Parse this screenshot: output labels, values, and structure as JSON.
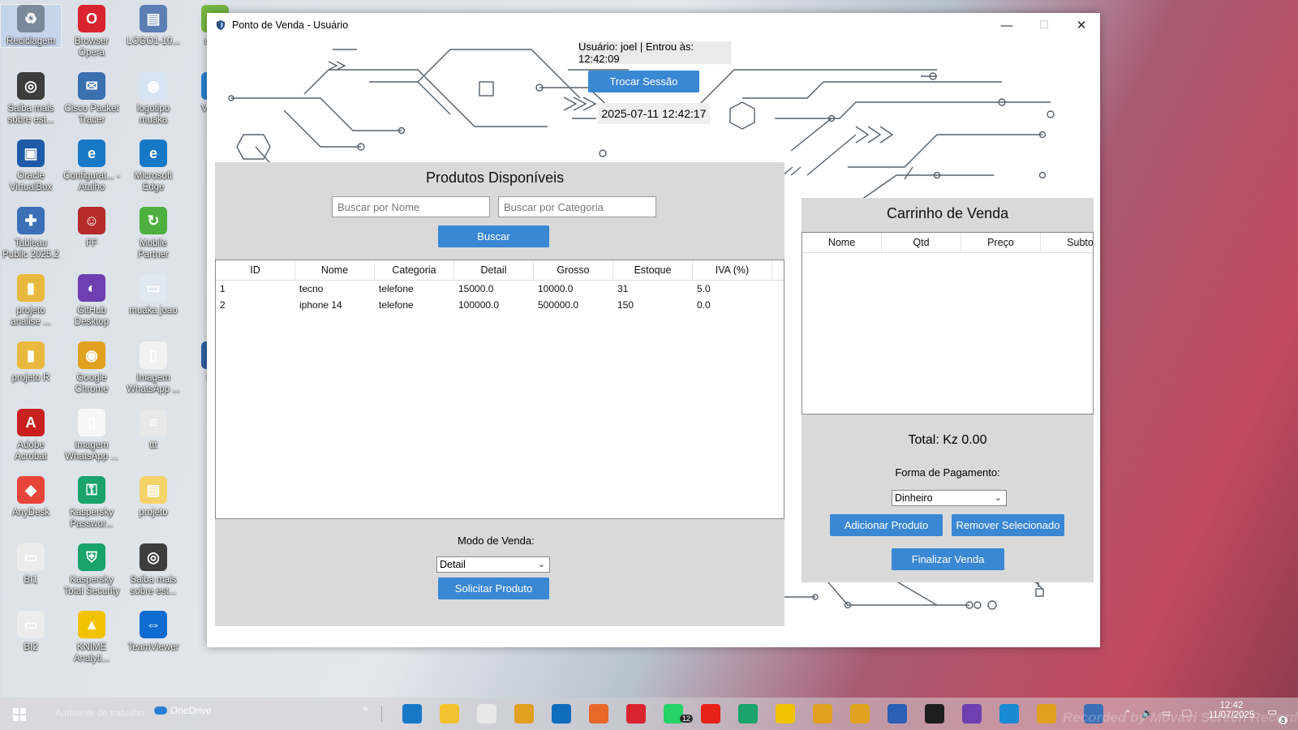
{
  "desktop": {
    "icons": [
      {
        "label": "Reciclagem",
        "color": "#7a8a9a",
        "glyph": "♻"
      },
      {
        "label": "Browser Opera",
        "color": "#d9232e",
        "glyph": "O"
      },
      {
        "label": "LOGO1-10...",
        "color": "#5b7fb5",
        "glyph": "▤"
      },
      {
        "label": "uTorr",
        "color": "#77b843",
        "glyph": "µ"
      },
      {
        "label": "Saiba mais sobre est...",
        "color": "#3d3d3d",
        "glyph": "◎"
      },
      {
        "label": "Cisco Packet Tracer",
        "color": "#3a6fb0",
        "glyph": "✉"
      },
      {
        "label": "logotipo muaka",
        "color": "#d5e3f2",
        "glyph": "◉"
      },
      {
        "label": "Visu C",
        "color": "#2c7fd0",
        "glyph": "V"
      },
      {
        "label": "Oracle VirtualBox",
        "color": "#1e5aa8",
        "glyph": "▣"
      },
      {
        "label": "Configurat... - Atalho",
        "color": "#1878c8",
        "glyph": "e"
      },
      {
        "label": "Microsoft Edge",
        "color": "#1878c8",
        "glyph": "e"
      },
      {
        "label": "Tableau Public 2025.2",
        "color": "#3b6fb6",
        "glyph": "✚"
      },
      {
        "label": "FF",
        "color": "#b52a2a",
        "glyph": "☺"
      },
      {
        "label": "Mobile Partner",
        "color": "#4caf3e",
        "glyph": "↻"
      },
      {
        "label": "projeto analise ...",
        "color": "#e8b93c",
        "glyph": "▮"
      },
      {
        "label": "GitHub Desktop",
        "color": "#6e3fb0",
        "glyph": "◐"
      },
      {
        "label": "muaka joao",
        "color": "#dfe7f0",
        "glyph": "▭"
      },
      {
        "label": "projeto R",
        "color": "#e8b93c",
        "glyph": "▮"
      },
      {
        "label": "Google Chrome",
        "color": "#e0a020",
        "glyph": "◉"
      },
      {
        "label": "Imagem WhatsApp ...",
        "color": "#f2f2f2",
        "glyph": "▯"
      },
      {
        "label": "Pho",
        "color": "#3060a0",
        "glyph": "P"
      },
      {
        "label": "Adobe Acrobat",
        "color": "#c8201e",
        "glyph": "A"
      },
      {
        "label": "Imagem WhatsApp ...",
        "color": "#f7f7f7",
        "glyph": "▯"
      },
      {
        "label": "ttt",
        "color": "#e8e8e8",
        "glyph": "≡"
      },
      {
        "label": "AnyDesk",
        "color": "#e8453a",
        "glyph": "◆"
      },
      {
        "label": "Kaspersky Passwor...",
        "color": "#1aa36b",
        "glyph": "⚿"
      },
      {
        "label": "projeto",
        "color": "#f3d36a",
        "glyph": "▤"
      },
      {
        "label": "BI1",
        "color": "#ececec",
        "glyph": "▭"
      },
      {
        "label": "Kaspersky Total Security",
        "color": "#1aa36b",
        "glyph": "⛨"
      },
      {
        "label": "Saiba mais sobre est...",
        "color": "#3d3d3d",
        "glyph": "◎"
      },
      {
        "label": "BI2",
        "color": "#ececec",
        "glyph": "▭"
      },
      {
        "label": "KNIME Analyti...",
        "color": "#f2c200",
        "glyph": "▲"
      },
      {
        "label": "TeamViewer",
        "color": "#0e6bd0",
        "glyph": "⇔"
      }
    ]
  },
  "window": {
    "title": "Ponto de Venda - Usuário",
    "minimize_glyph": "—",
    "maximize_glyph": "☐",
    "close_glyph": "✕"
  },
  "header": {
    "user_info": "Usuário: joel | Entrou às: 12:42:09",
    "switch_session_label": "Trocar Sessão",
    "datetime": "2025-07-11 12:42:17"
  },
  "products": {
    "title": "Produtos Disponíveis",
    "search_name_placeholder": "Buscar por Nome",
    "search_category_placeholder": "Buscar por Categoria",
    "search_button": "Buscar",
    "columns": [
      "ID",
      "Nome",
      "Categoria",
      "Detail",
      "Grosso",
      "Estoque",
      "IVA (%)"
    ],
    "rows": [
      [
        "1",
        "tecno",
        "telefone",
        "15000.0",
        "10000.0",
        "31",
        "5.0"
      ],
      [
        "2",
        "iphone 14",
        "telefone",
        "100000.0",
        "500000.0",
        "150",
        "0.0"
      ]
    ],
    "sale_mode_label": "Modo de Venda:",
    "sale_mode_value": "Detail",
    "request_button": "Solicitar Produto"
  },
  "cart": {
    "title": "Carrinho de Venda",
    "columns": [
      "Nome",
      "Qtd",
      "Preço",
      "Subto"
    ],
    "total": "Total: Kz 0.00",
    "payment_label": "Forma de Pagamento:",
    "payment_value": "Dinheiro",
    "add_button": "Adicionar Produto",
    "remove_button": "Remover Selecionado",
    "finish_button": "Finalizar Venda"
  },
  "taskbar": {
    "workspace_label": "Ambiente de trabalho",
    "onedrive_label": "OneDrive",
    "chevron": "»",
    "time": "12:42",
    "date": "11/07/2025",
    "whatsapp_badge": "12",
    "notification_count": "8",
    "watermark": "Recorded by Movavi Screen Recorder"
  },
  "colors": {
    "accent_button": "#3a87d4",
    "panel_bg": "#d9d9d9"
  }
}
